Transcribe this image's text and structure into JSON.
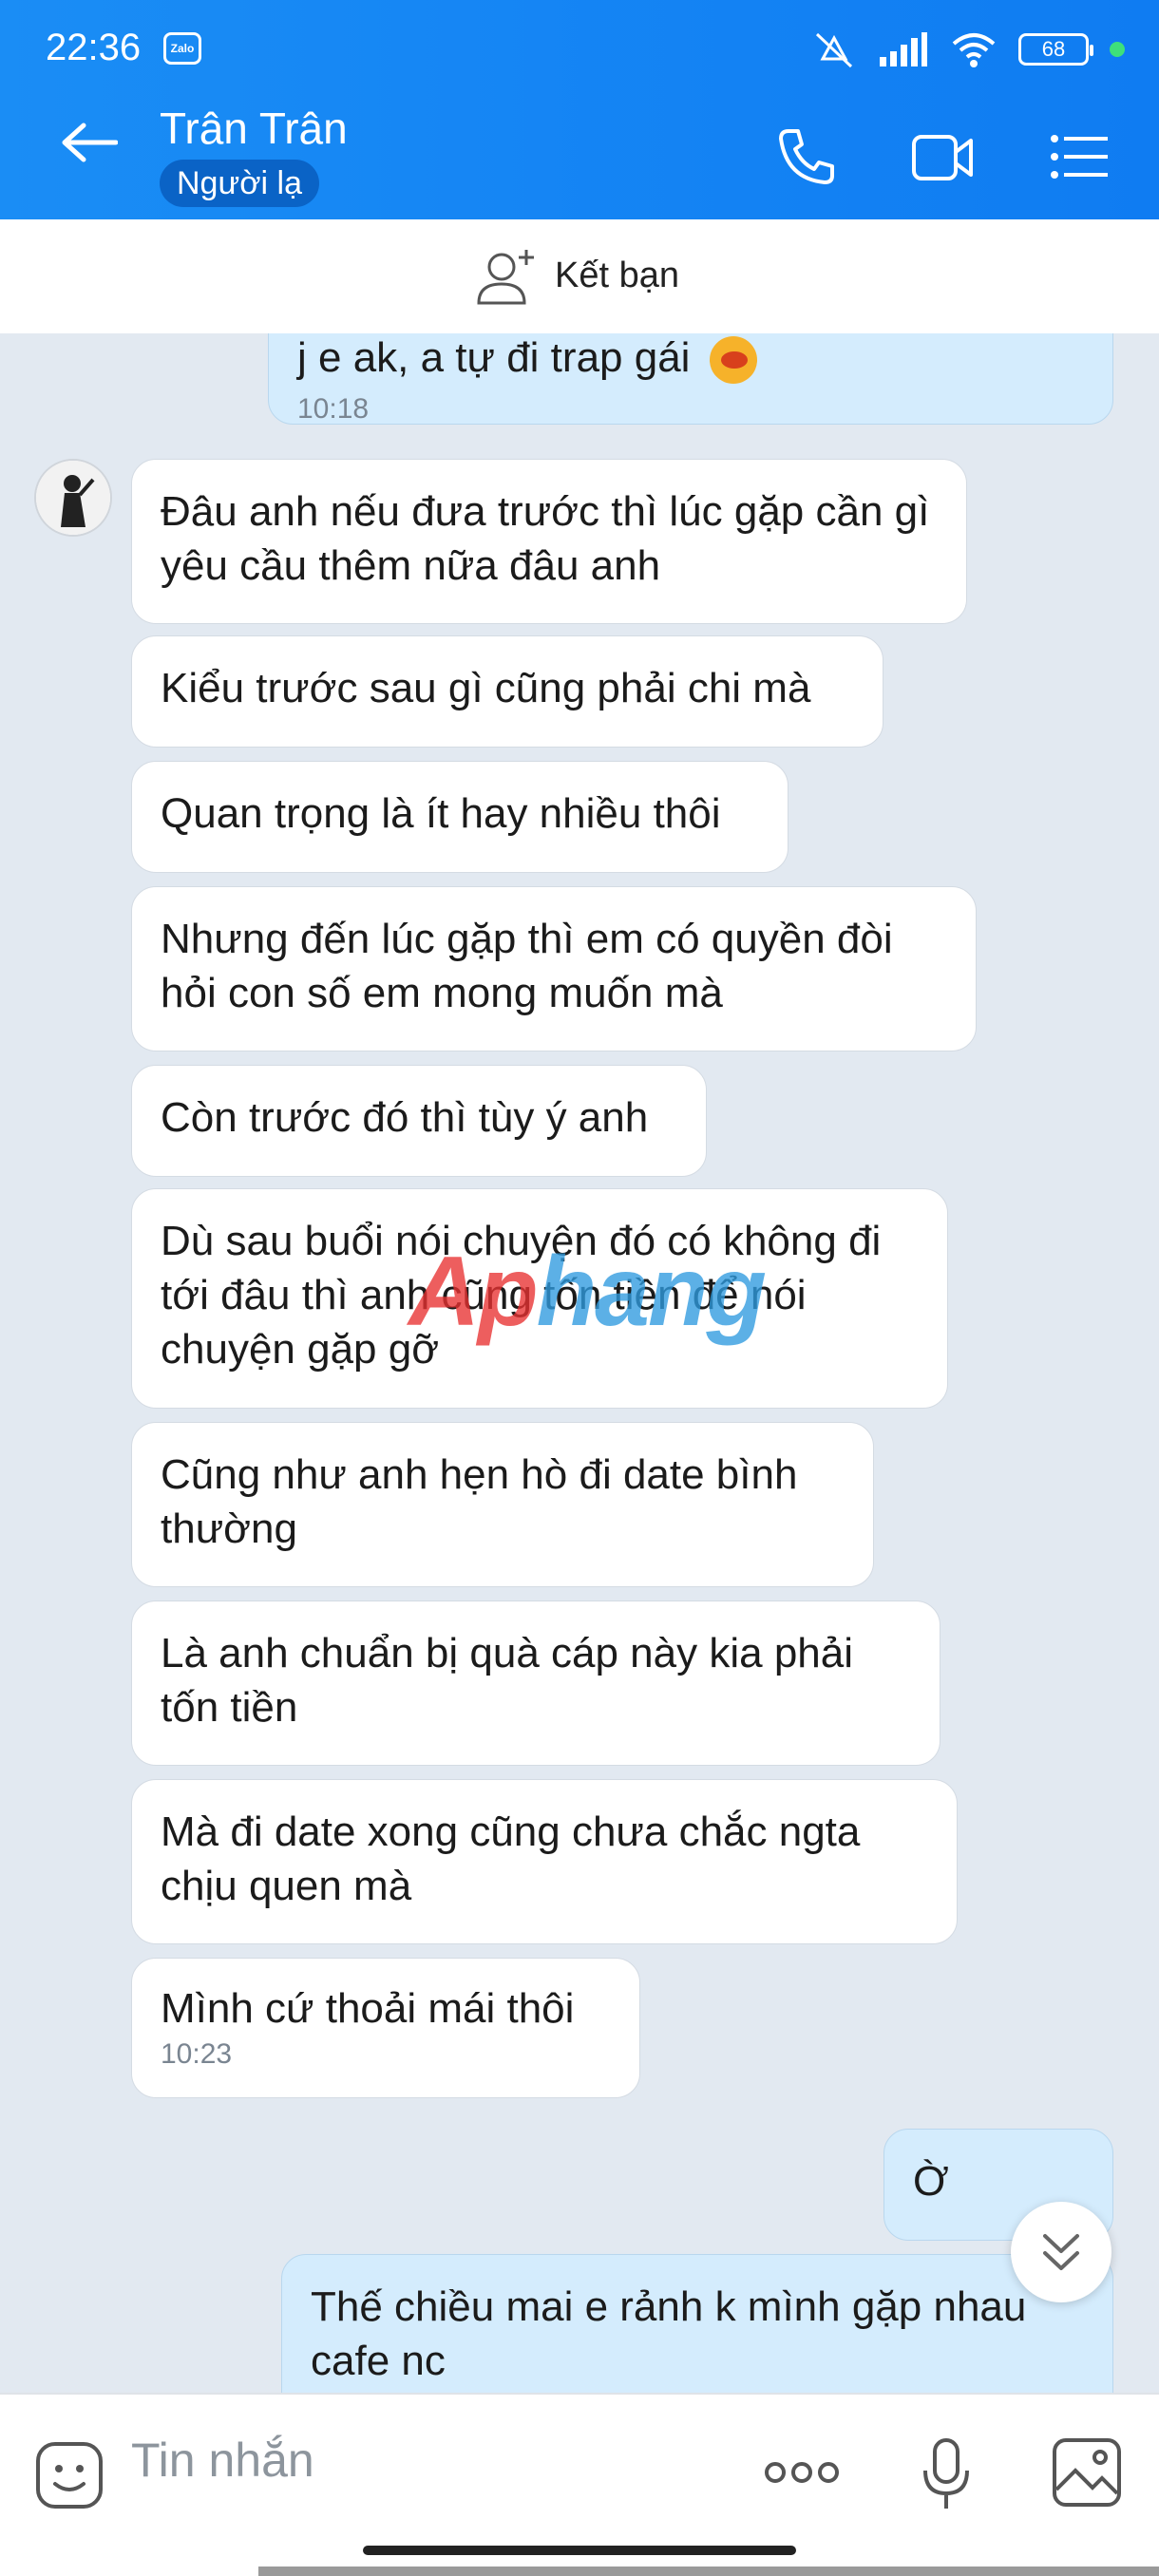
{
  "status_bar": {
    "time": "22:36",
    "app_badge": "Zalo",
    "battery": "68"
  },
  "header": {
    "contact_name": "Trân Trân",
    "badge": "Người lạ"
  },
  "friend_bar": {
    "label": "Kết bạn"
  },
  "messages": {
    "top_partial": {
      "text": "j e ak, a tự đi trap gái",
      "time": "10:18"
    },
    "m1": "Đâu anh nếu đưa trước thì lúc gặp cần gì yêu cầu thêm nữa đâu anh",
    "m2": "Kiểu trước sau gì cũng phải chi mà",
    "m3": "Quan trọng là ít hay nhiều thôi",
    "m4": "Nhưng đến lúc gặp thì em có quyền đòi hỏi con số em mong muốn mà",
    "m5": "Còn trước đó thì tùy ý anh",
    "m6": "Dù sau buổi nói chuyện đó có không đi tới đâu thì anh cũng tốn tiền để nói chuyện gặp gỡ",
    "m7": "Cũng như anh hẹn hò đi date bình thường",
    "m8": "Là anh chuẩn bị quà cáp này kia phải tốn tiền",
    "m9": "Mà đi date xong cũng chưa chắc ngta chịu quen mà",
    "m10": {
      "text": "Mình cứ thoải mái thôi",
      "time": "10:23"
    },
    "me1": "Ờ",
    "me2": "Thế chiều mai e rảnh k mình gặp nhau cafe nc"
  },
  "watermark": {
    "part_a": "Ap",
    "part_b": "hang"
  },
  "input": {
    "placeholder": "Tin nhắn"
  },
  "colors": {
    "header": "#1a8df5",
    "outgoing_bubble": "#d4ecfd",
    "background": "#e2e9f1"
  }
}
